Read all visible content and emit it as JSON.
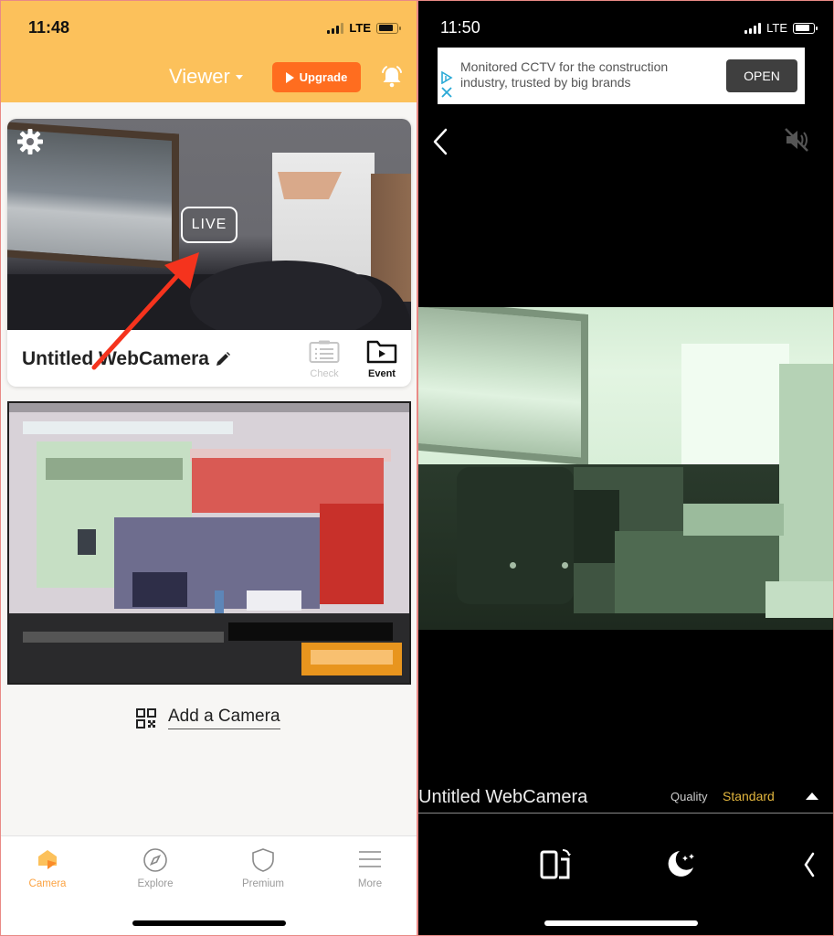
{
  "left_phone": {
    "status_bar": {
      "time": "11:48",
      "network": "LTE"
    },
    "header": {
      "viewer_label": "Viewer",
      "upgrade_label": "Upgrade",
      "accent_color": "#fcc15b",
      "upgrade_color": "#ff6d1f"
    },
    "camera_card": {
      "live_label": "LIVE",
      "camera_name": "Untitled WebCamera",
      "actions": [
        {
          "label": "Check",
          "icon": "checklist-icon",
          "enabled": false
        },
        {
          "label": "Event",
          "icon": "folder-play-icon",
          "enabled": true
        }
      ]
    },
    "add_camera_label": "Add a Camera",
    "tabbar": {
      "items": [
        {
          "label": "Camera",
          "icon": "camera-home-icon",
          "active": true
        },
        {
          "label": "Explore",
          "icon": "compass-icon",
          "active": false
        },
        {
          "label": "Premium",
          "icon": "shield-icon",
          "active": false
        },
        {
          "label": "More",
          "icon": "menu-icon",
          "active": false
        }
      ],
      "active_color": "#fba343"
    }
  },
  "right_phone": {
    "status_bar": {
      "time": "11:50",
      "network": "LTE"
    },
    "ad": {
      "text": "Monitored CCTV for the construction industry, trusted by big brands",
      "open_label": "OPEN"
    },
    "camera_name": "Untitled WebCamera",
    "quality_label": "Quality",
    "quality_value": "Standard",
    "quality_color": "#e2b63e"
  }
}
